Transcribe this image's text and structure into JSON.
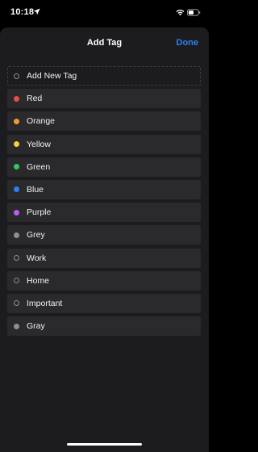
{
  "status_bar": {
    "time": "10:18",
    "icons": [
      "location-arrow-icon",
      "wifi-icon",
      "battery-icon"
    ]
  },
  "nav": {
    "title": "Add Tag",
    "done_label": "Done"
  },
  "colors": {
    "accent": "#2f7ff3",
    "sheet_background": "#1c1c1e",
    "row_background": "#2a2a2c"
  },
  "tags": [
    {
      "label": "Add New Tag",
      "color": null,
      "style": "outline"
    },
    {
      "label": "Red",
      "color": "#eb4a45",
      "style": "filled"
    },
    {
      "label": "Orange",
      "color": "#f09a37",
      "style": "filled"
    },
    {
      "label": "Yellow",
      "color": "#f4d13a",
      "style": "filled"
    },
    {
      "label": "Green",
      "color": "#34c759",
      "style": "filled"
    },
    {
      "label": "Blue",
      "color": "#2f7ff3",
      "style": "filled"
    },
    {
      "label": "Purple",
      "color": "#bf5af2",
      "style": "filled"
    },
    {
      "label": "Grey",
      "color": "#8e8e93",
      "style": "filled"
    },
    {
      "label": "Work",
      "color": null,
      "style": "outline"
    },
    {
      "label": "Home",
      "color": null,
      "style": "outline"
    },
    {
      "label": "Important",
      "color": null,
      "style": "outline"
    },
    {
      "label": "Gray",
      "color": "#8e8e93",
      "style": "filled"
    }
  ]
}
